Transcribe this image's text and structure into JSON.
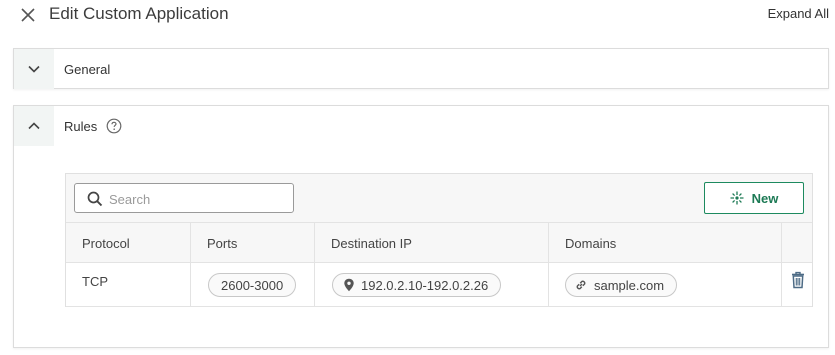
{
  "header": {
    "title": "Edit Custom Application",
    "expand_all_label": "Expand All"
  },
  "sections": {
    "general": {
      "label": "General",
      "expanded": false
    },
    "rules": {
      "label": "Rules",
      "expanded": true
    }
  },
  "toolbar": {
    "search_placeholder": "Search",
    "search_value": "",
    "new_button_label": "New"
  },
  "table": {
    "columns": [
      "Protocol",
      "Ports",
      "Destination IP",
      "Domains"
    ],
    "rows": [
      {
        "protocol": "TCP",
        "ports": "2600-3000",
        "destination_ip": "192.0.2.10-192.0.2.26",
        "domains": "sample.com"
      }
    ]
  },
  "colors": {
    "accent_green": "#1d7a55",
    "border": "#dcdcdc",
    "chevron_bg": "#f2f5f4"
  },
  "icons": [
    "close-icon",
    "chevron-down-icon",
    "chevron-up-icon",
    "help-icon",
    "search-icon",
    "new-sparkle-icon",
    "location-pin-icon",
    "link-icon",
    "trash-icon"
  ]
}
